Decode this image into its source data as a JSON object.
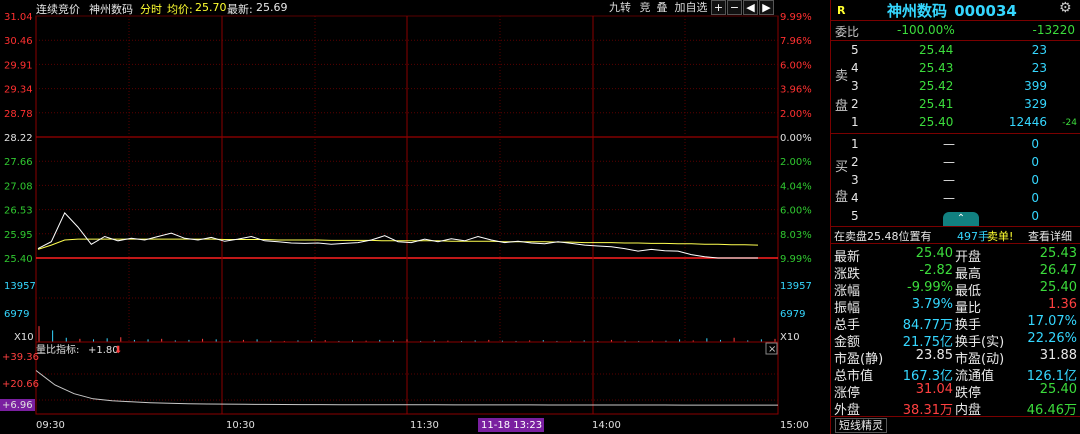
{
  "topbar": {
    "mode": "连续竞价",
    "stock_name": "神州数码",
    "view": "分时",
    "avg_label": "均价:",
    "avg_value": "25.70",
    "last_label": "最新:",
    "last_value": "25.69",
    "buttons": [
      "九转",
      "竞",
      "叠",
      "加自选"
    ],
    "ctrl_icons": [
      "plus-icon",
      "minus-icon",
      "prev-icon",
      "next-icon"
    ]
  },
  "chart_data": {
    "type": "line",
    "title": "",
    "y_price_ticks": [
      "31.04",
      "30.46",
      "29.91",
      "29.34",
      "28.78",
      "28.22",
      "27.66",
      "27.08",
      "26.53",
      "25.95",
      "25.40"
    ],
    "y_pct_ticks": [
      "9.99%",
      "7.96%",
      "6.00%",
      "3.96%",
      "2.00%",
      "0.00%",
      "2.00%",
      "4.04%",
      "6.00%",
      "8.03%",
      "9.99%"
    ],
    "ylim": [
      25.4,
      31.04
    ],
    "prev_close": 28.22,
    "volume_ticks": [
      "13957",
      "6979"
    ],
    "volume_unit": "X10",
    "ratio_indicator": {
      "label": "量比指标:",
      "value": "+1.80",
      "arrow": "⬇",
      "ticks": [
        "+39.36",
        "+20.66",
        "+6.96"
      ]
    },
    "x_ticks": [
      "09:30",
      "10:30",
      "11:30",
      "14:00",
      "15:00"
    ],
    "cursor_time": "11-18 13:23",
    "series": [
      {
        "name": "",
        "color": "#ffffff",
        "values": [
          25.62,
          25.78,
          26.45,
          26.12,
          25.72,
          25.9,
          25.8,
          25.86,
          25.82,
          25.9,
          25.98,
          25.86,
          25.82,
          25.88,
          25.79,
          25.84,
          25.9,
          25.8,
          25.78,
          25.75,
          25.74,
          25.75,
          25.72,
          25.74,
          25.76,
          25.82,
          25.92,
          25.78,
          25.76,
          25.84,
          25.78,
          25.85,
          25.8,
          25.9,
          25.82,
          25.76,
          25.79,
          25.75,
          25.73,
          25.78,
          25.74,
          25.7,
          25.68,
          25.66,
          25.62,
          25.56,
          25.6,
          25.57,
          25.56,
          25.48,
          25.43,
          25.4,
          25.4,
          25.4,
          25.4
        ]
      },
      {
        "name": "",
        "color": "#ffff50",
        "values": [
          25.6,
          25.7,
          25.82,
          25.84,
          25.84,
          25.84,
          25.84,
          25.84,
          25.84,
          25.84,
          25.84,
          25.84,
          25.84,
          25.84,
          25.83,
          25.83,
          25.83,
          25.83,
          25.82,
          25.82,
          25.82,
          25.82,
          25.81,
          25.81,
          25.81,
          25.81,
          25.8,
          25.8,
          25.8,
          25.8,
          25.8,
          25.79,
          25.79,
          25.79,
          25.79,
          25.78,
          25.78,
          25.78,
          25.78,
          25.77,
          25.77,
          25.76,
          25.76,
          25.76,
          25.75,
          25.75,
          25.74,
          25.74,
          25.73,
          25.73,
          25.72,
          25.72,
          25.71,
          25.71,
          25.7
        ]
      },
      {
        "name": "",
        "color": "#c8c8c8",
        "values": [
          30,
          20,
          14,
          10.5,
          9.2,
          8.4,
          7.8,
          7.4,
          7.1,
          6.9,
          6.8,
          6.7,
          6.6,
          6.55,
          6.5,
          6.46,
          6.42,
          6.4,
          6.38,
          6.36,
          6.34,
          6.32,
          6.3,
          6.28,
          6.27,
          6.26,
          6.25,
          6.24,
          6.23,
          6.22,
          6.21,
          6.2,
          6.19,
          6.18,
          6.17,
          6.16,
          6.15,
          6.14,
          6.13,
          6.12
        ]
      }
    ],
    "volume": [
      3000,
      2200,
      800,
      600,
      500,
      700,
      900,
      400,
      500,
      600,
      300,
      400,
      600,
      500,
      300,
      400,
      500,
      300,
      200,
      300,
      400,
      350,
      200,
      300,
      250,
      400,
      300,
      500,
      200,
      300,
      250,
      200,
      300,
      400,
      250,
      200,
      300,
      350,
      200,
      250,
      300,
      200,
      400,
      250,
      200,
      300,
      250,
      500,
      300,
      700,
      400,
      800,
      300,
      500,
      600
    ]
  },
  "quote": {
    "header_badge": "R",
    "title": "神州数码",
    "code": "000034",
    "weibi_label": "委比",
    "weibi_pct": "-100.00%",
    "weibi_diff": "-13220",
    "sell_label": [
      "卖",
      "盘"
    ],
    "buy_label": [
      "买",
      "盘"
    ],
    "sell": [
      {
        "lvl": "5",
        "price": "25.44",
        "vol": "23",
        "chg": ""
      },
      {
        "lvl": "4",
        "price": "25.43",
        "vol": "23",
        "chg": ""
      },
      {
        "lvl": "3",
        "price": "25.42",
        "vol": "399",
        "chg": ""
      },
      {
        "lvl": "2",
        "price": "25.41",
        "vol": "329",
        "chg": ""
      },
      {
        "lvl": "1",
        "price": "25.40",
        "vol": "12446",
        "chg": "-24"
      }
    ],
    "buy": [
      {
        "lvl": "1",
        "price": "—",
        "vol": "0"
      },
      {
        "lvl": "2",
        "price": "—",
        "vol": "0"
      },
      {
        "lvl": "3",
        "price": "—",
        "vol": "0"
      },
      {
        "lvl": "4",
        "price": "—",
        "vol": "0"
      },
      {
        "lvl": "5",
        "price": "—",
        "vol": "0"
      }
    ],
    "queue_text": "在卖盘25.48位置有",
    "queue_count": "497手",
    "queue_unit": "卖单!",
    "queue_link": "查看详细",
    "stats": [
      {
        "l1": "最新",
        "v1": "25.40",
        "c1": "green",
        "l2": "开盘",
        "v2": "25.43",
        "c2": "green"
      },
      {
        "l1": "涨跌",
        "v1": "-2.82",
        "c1": "green",
        "l2": "最高",
        "v2": "26.47",
        "c2": "green"
      },
      {
        "l1": "涨幅",
        "v1": "-9.99%",
        "c1": "green",
        "l2": "最低",
        "v2": "25.40",
        "c2": "green"
      },
      {
        "l1": "振幅",
        "v1": "3.79%",
        "c1": "cyan",
        "l2": "量比",
        "v2": "1.36",
        "c2": "red"
      },
      {
        "l1": "总手",
        "v1": "84.77万",
        "c1": "cyan",
        "l2": "换手",
        "v2": "17.07%",
        "c2": "cyan"
      },
      {
        "l1": "金额",
        "v1": "21.75亿",
        "c1": "cyan",
        "l2": "换手(实)",
        "v2": "22.26%",
        "c2": "cyan"
      },
      {
        "l1": "市盈(静)",
        "v1": "23.85",
        "c1": "white",
        "l2": "市盈(动)",
        "v2": "31.88",
        "c2": "white"
      },
      {
        "l1": "总市值",
        "v1": "167.3亿",
        "c1": "cyan",
        "l2": "流通值",
        "v2": "126.1亿",
        "c2": "cyan"
      },
      {
        "l1": "涨停",
        "v1": "31.04",
        "c1": "red",
        "l2": "跌停",
        "v2": "25.40",
        "c2": "green"
      },
      {
        "l1": "外盘",
        "v1": "38.31万",
        "c1": "red",
        "l2": "内盘",
        "v2": "46.46万",
        "c2": "green"
      }
    ],
    "footer_tab": "短线精灵"
  }
}
